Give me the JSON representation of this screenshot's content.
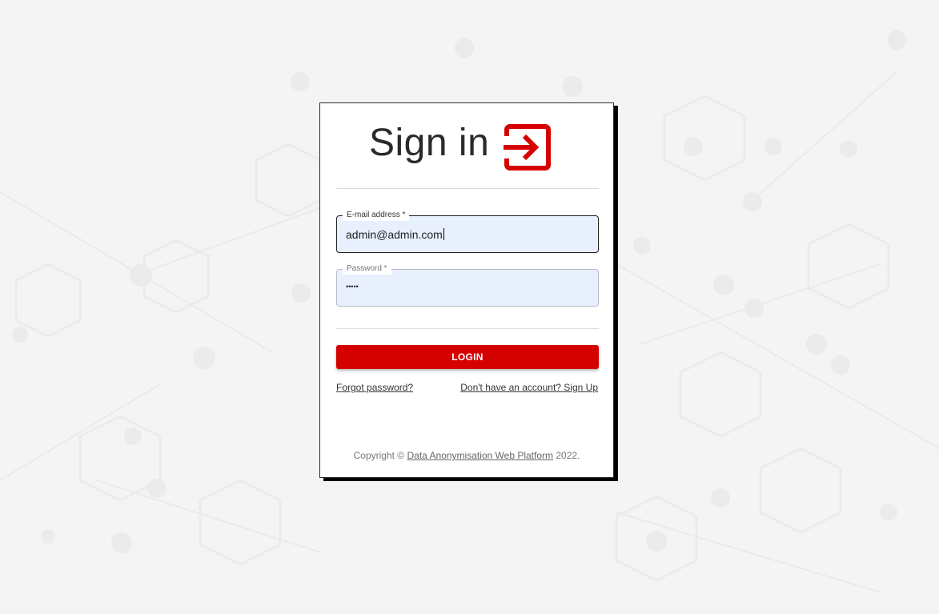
{
  "page": {
    "title": "Sign in",
    "accent_color": "#d50000"
  },
  "logo": {
    "icon": "sign-in-arrow-icon"
  },
  "form": {
    "email": {
      "label": "E-mail address *",
      "value": "admin@admin.com"
    },
    "password": {
      "label": "Password *",
      "masked_value": "•••••"
    },
    "login_label": "LOGIN"
  },
  "links": {
    "forgot_password": "Forgot password?",
    "sign_up": "Don't have an account? Sign Up"
  },
  "footer": {
    "prefix": "Copyright © ",
    "link_text": "Data Anonymisation Web Platform",
    "suffix": " 2022."
  }
}
